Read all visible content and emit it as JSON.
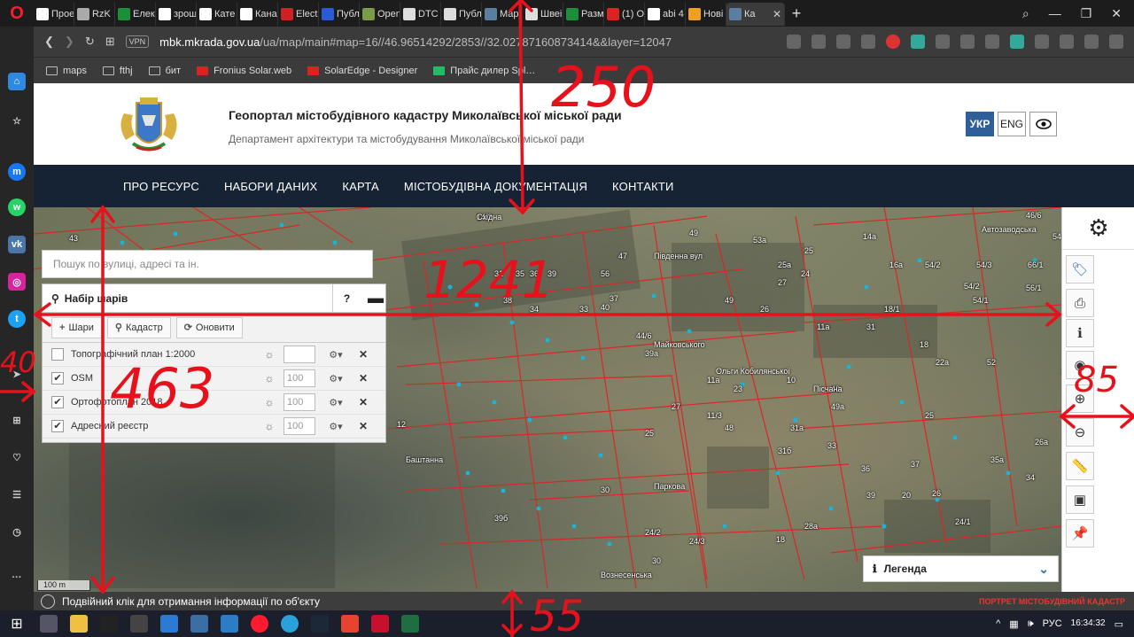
{
  "browser": {
    "tabs": [
      {
        "label": "Прое",
        "color": "#ffffff"
      },
      {
        "label": "RzK",
        "color": "#aaaaaa"
      },
      {
        "label": "Елек",
        "color": "#1b8f3a"
      },
      {
        "label": "зрош",
        "color": "#ffffff"
      },
      {
        "label": "Кате",
        "color": "#ffffff"
      },
      {
        "label": "Кана",
        "color": "#ffffff"
      },
      {
        "label": "Elect",
        "color": "#cc2222"
      },
      {
        "label": "Публ",
        "color": "#2a5bd7"
      },
      {
        "label": "Open",
        "color": "#7a9a4a"
      },
      {
        "label": "DTC",
        "color": "#dddddd"
      },
      {
        "label": "Публ",
        "color": "#dddddd"
      },
      {
        "label": "Марі",
        "color": "#5a7fa0"
      },
      {
        "label": "Швеі",
        "color": "#dddddd"
      },
      {
        "label": "Разм",
        "color": "#1b8f3a"
      },
      {
        "label": "(1) О",
        "color": "#dd2222"
      },
      {
        "label": "abi 4",
        "color": "#ffffff"
      },
      {
        "label": "Нові",
        "color": "#f0a020"
      }
    ],
    "active_tab": {
      "label": "Ка"
    },
    "new_tab": "+",
    "vpn_label": "VPN",
    "url_domain": "mbk.mkrada.gov.ua",
    "url_rest": "/ua/map/main#map=16//46.96514292/2853//32.02787160873414&&layer=12047",
    "bookmarks": [
      {
        "label": "maps",
        "type": "folder"
      },
      {
        "label": "fthj",
        "type": "folder"
      },
      {
        "label": "бит",
        "type": "folder"
      },
      {
        "label": "Fronius Solar.web",
        "type": "red"
      },
      {
        "label": "SolarEdge - Designer",
        "type": "red"
      },
      {
        "label": "Прайс дилер Spl…",
        "type": "green"
      }
    ]
  },
  "site": {
    "title": "Геопортал містобудівного кадастру Миколаївської міської ради",
    "subtitle": "Департамент архітектури та містобудування Миколаївської міської ради",
    "lang_ukr": "УКР",
    "lang_eng": "ENG",
    "nav": [
      "ПРО РЕСУРС",
      "НАБОРИ ДАНИХ",
      "КАРТА",
      "МІСТОБУДІВНА ДОКУМЕНТАЦІЯ",
      "КОНТАКТИ"
    ]
  },
  "map": {
    "search_placeholder": "Пошук по вулиці, адресі та ін.",
    "layers_title": "Набір шарів",
    "help": "?",
    "tools": [
      "Шари",
      "Кадастр",
      "Оновити"
    ],
    "layers": [
      {
        "name": "Топографічний план 1:2000",
        "checked": false,
        "opacity": ""
      },
      {
        "name": "OSM",
        "checked": true,
        "opacity": "100"
      },
      {
        "name": "Ортофотоплан 2018",
        "checked": true,
        "opacity": "100"
      },
      {
        "name": "Адресний реєстр",
        "checked": true,
        "opacity": "100"
      }
    ],
    "legend": "Легенда",
    "scale": "100 m",
    "status": "Подвійний клік для отримання інформації по об'єкту",
    "footer_logo": "ПОРТРЕТ МІСТОБУДІВНИЙ КАДАСТР",
    "labels": [
      "14/2",
      "49",
      "53а",
      "25",
      "14а",
      "54/2",
      "46/6",
      "43",
      "49",
      "16а",
      "54/3",
      "66/1",
      "31",
      "35",
      "36",
      "39",
      "56",
      "47",
      "25а",
      "24",
      "27",
      "54/2",
      "56/1",
      "38",
      "34",
      "33",
      "40",
      "37",
      "26",
      "18/1",
      "54/1",
      "54",
      "44/6",
      "11а",
      "31",
      "18",
      "22а",
      "52",
      "39а",
      "11а",
      "10",
      "40",
      "25",
      "24/1",
      "49а",
      "48",
      "31а",
      "33",
      "35а",
      "26а",
      "34",
      "36",
      "31б",
      "37",
      "20",
      "30",
      "28а",
      "24/3",
      "18",
      "39",
      "24/2",
      "26",
      "30",
      "24/1",
      "39б",
      "11/3",
      "23",
      "25",
      "27",
      "12",
      "Баштанна",
      "Пісчана",
      "Вознесенська",
      "Паркова",
      "Південна вул",
      "Автозаводська",
      "Ольги Кобилянської",
      "Майковського",
      "Східна"
    ]
  },
  "annotations": {
    "n250": "250",
    "n1241": "1241",
    "n40": "40",
    "n463": "463",
    "n85": "85",
    "n55": "55"
  },
  "taskbar": {
    "lang": "РУС",
    "time": "16:34:32"
  }
}
